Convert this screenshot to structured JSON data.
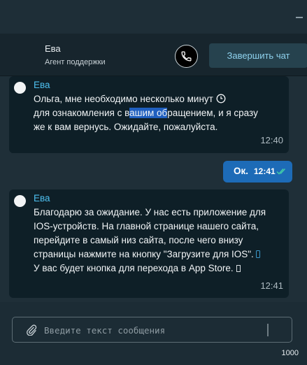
{
  "header": {
    "agent_name": "Ева",
    "agent_role": "Агент поддержки",
    "end_chat_label": "Завершить чат"
  },
  "messages": [
    {
      "sender": "Ева",
      "text_before_highlight": "Ольга, мне необходимо несколько минут ",
      "text_line2_a": "для ознакомления с в",
      "highlight": "ашим об",
      "text_line2_b": "ращением, и я сразу же к вам вернусь. Ожидайте, пожалуйста.",
      "time": "12:40",
      "icon": "clock-icon"
    },
    {
      "sender": "Ева",
      "text_a": "Благодарю за ожидание. У нас есть приложение для IOS-устройств. На главной странице нашего сайта, перейдите в самый низ сайта, после чего внизу страницы нажмите на кнопку \"Загрузите для IOS\".",
      "text_b": " У вас будет кнопка для перехода в App Store.",
      "time": "12:41",
      "icons": [
        "mobile-phone-icon",
        "missing-glyph-icon"
      ]
    }
  ],
  "reply": {
    "text": "Ок.",
    "time": "12:41",
    "status_icon": "double-check-icon"
  },
  "composer": {
    "placeholder": "Введите текст сообщения",
    "value": "",
    "char_counter": "1000"
  },
  "colors": {
    "background": "#1f2f38",
    "bubble": "#0e1f27",
    "reply_bubble": "#1d6bb7",
    "sender_accent": "#4ec0f0",
    "end_chat_text": "#8fd2ee"
  }
}
